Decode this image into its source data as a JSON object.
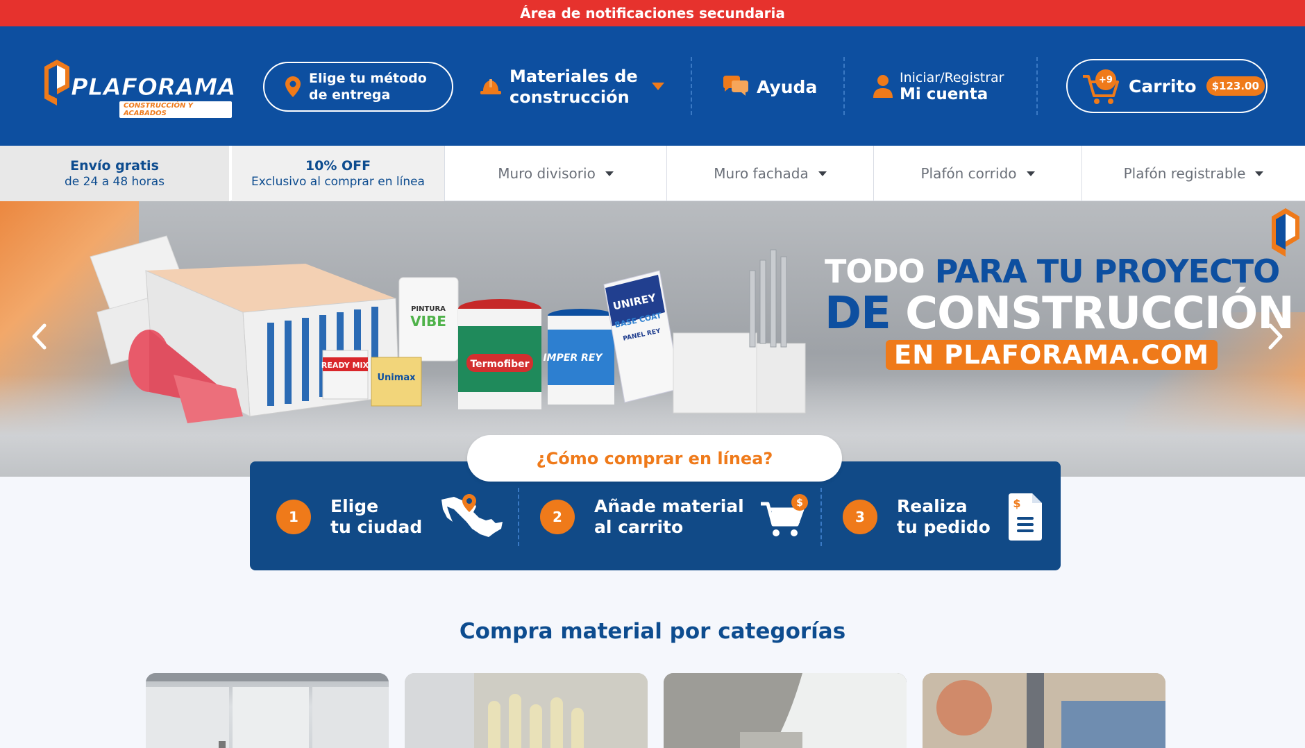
{
  "notification": {
    "text": "Área de notificaciones secundaria"
  },
  "brand": {
    "name": "PLAFORAMA",
    "tagline": "CONSTRUCCIÓN Y ACABADOS",
    "colors": {
      "blue": "#0d4fa0",
      "orange": "#ef7a1a",
      "red": "#e6322d"
    }
  },
  "header": {
    "delivery": {
      "label": "Elige tu método de entrega",
      "icon": "location-pin-icon"
    },
    "materials": {
      "label": "Materiales de construcción",
      "icon": "hard-hat-icon"
    },
    "help": {
      "label": "Ayuda",
      "icon": "chat-bubbles-icon"
    },
    "account": {
      "line1": "Iniciar/Registrar",
      "line2": "Mi cuenta",
      "icon": "user-icon"
    },
    "cart": {
      "label": "Carrito",
      "count": "+9",
      "total": "$123.00",
      "icon": "cart-icon"
    }
  },
  "subnav": {
    "promos": [
      {
        "title": "Envío gratis",
        "subtitle": "de 24 a 48 horas"
      },
      {
        "title": "10% OFF",
        "subtitle": "Exclusivo al comprar en línea"
      }
    ],
    "items": [
      {
        "label": "Muro divisorio"
      },
      {
        "label": "Muro fachada"
      },
      {
        "label": "Plafón corrido"
      },
      {
        "label": "Plafón registrable"
      }
    ]
  },
  "hero": {
    "line1_a": "TODO ",
    "line1_b": "PARA TU PROYECTO",
    "line2_a": "DE ",
    "line2_b": "CONSTRUCCIÓN",
    "line3": "EN PLAFORAMA.COM",
    "product_labels": {
      "ready_mix": "READY MIX",
      "unimax": "Unimax",
      "termofiber": "Termofiber",
      "imper_rey": "IMPER REY",
      "unirey": "UNIREY",
      "base_coat": "BASE COAT",
      "panel_rey": "PANEL REY",
      "vibe": "VIBE",
      "pintura": "PINTURA"
    }
  },
  "howto": {
    "button": "¿Cómo comprar en línea?",
    "steps": [
      {
        "num": "1",
        "line1": "Elige",
        "line2": "tu ciudad",
        "icon": "mexico-map-icon"
      },
      {
        "num": "2",
        "line1": "Añade material",
        "line2": "al carrito",
        "icon": "cart-dollar-icon"
      },
      {
        "num": "3",
        "line1": "Realiza",
        "line2": "tu pedido",
        "icon": "invoice-icon"
      }
    ]
  },
  "categories": {
    "title": "Compra material por categorías"
  }
}
